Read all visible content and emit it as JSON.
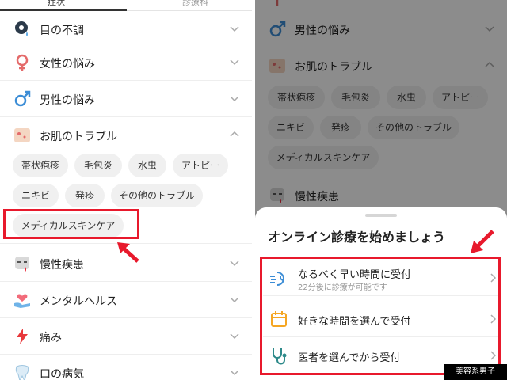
{
  "left": {
    "tabs": [
      "症状",
      "診療科"
    ],
    "categories": [
      {
        "label": "目の不調"
      },
      {
        "label": "女性の悩み"
      },
      {
        "label": "男性の悩み"
      },
      {
        "label": "お肌のトラブル"
      },
      {
        "label": "慢性疾患"
      },
      {
        "label": "メンタルヘルス"
      },
      {
        "label": "痛み"
      },
      {
        "label": "口の病気"
      }
    ],
    "chips": [
      "帯状疱疹",
      "毛包炎",
      "水虫",
      "アトピー",
      "ニキビ",
      "発疹",
      "その他のトラブル",
      "メディカルスキンケア"
    ]
  },
  "right": {
    "categories": [
      {
        "label": "男性の悩み"
      },
      {
        "label": "お肌のトラブル"
      },
      {
        "label": "慢性疾患"
      }
    ],
    "chips": [
      "帯状疱疹",
      "毛包炎",
      "水虫",
      "アトピー",
      "ニキビ",
      "発疹",
      "その他のトラブル",
      "メディカルスキンケア"
    ],
    "sheet": {
      "title": "オンライン診療を始めましょう",
      "options": [
        {
          "title": "なるべく早い時間に受付",
          "subtitle": "22分後に診療が可能です"
        },
        {
          "title": "好きな時間を選んで受付"
        },
        {
          "title": "医者を選んでから受付"
        }
      ]
    }
  },
  "watermark": "美容系男子",
  "colors": {
    "highlight": "#e8192c",
    "chip_bg": "#f0f0f0",
    "accent_orange": "#f5a623",
    "accent_teal": "#2d8a8a"
  }
}
